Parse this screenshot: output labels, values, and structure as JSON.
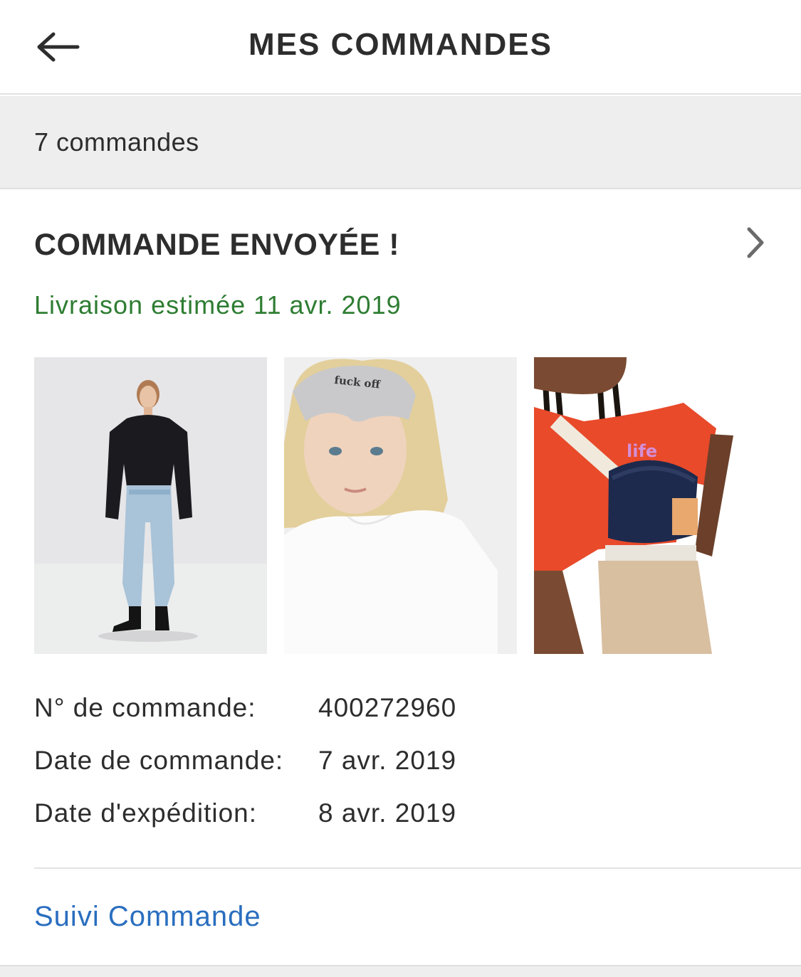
{
  "header": {
    "back_icon": "arrow-left-icon",
    "title": "MES COMMANDES"
  },
  "orders": {
    "count_label": "7 commandes"
  },
  "order": {
    "status": "COMMANDE ENVOYÉE !",
    "chevron_icon": "chevron-right-icon",
    "delivery_estimate": "Livraison estimée 11 avr. 2019",
    "delivery_color": "#2e7d32",
    "products": [
      {
        "name": "sweater-jeans-outfit"
      },
      {
        "name": "sleep-mask-tshirt",
        "print": "fuck off"
      },
      {
        "name": "denim-bumbag-outfit",
        "print": "life"
      }
    ],
    "details": [
      {
        "label": "N° de commande:",
        "value": "400272960"
      },
      {
        "label": "Date de commande:",
        "value": "7 avr. 2019"
      },
      {
        "label": "Date d'expédition:",
        "value": "8 avr. 2019"
      }
    ],
    "tracking_label": "Suivi Commande",
    "tracking_color": "#2a6ebf"
  }
}
